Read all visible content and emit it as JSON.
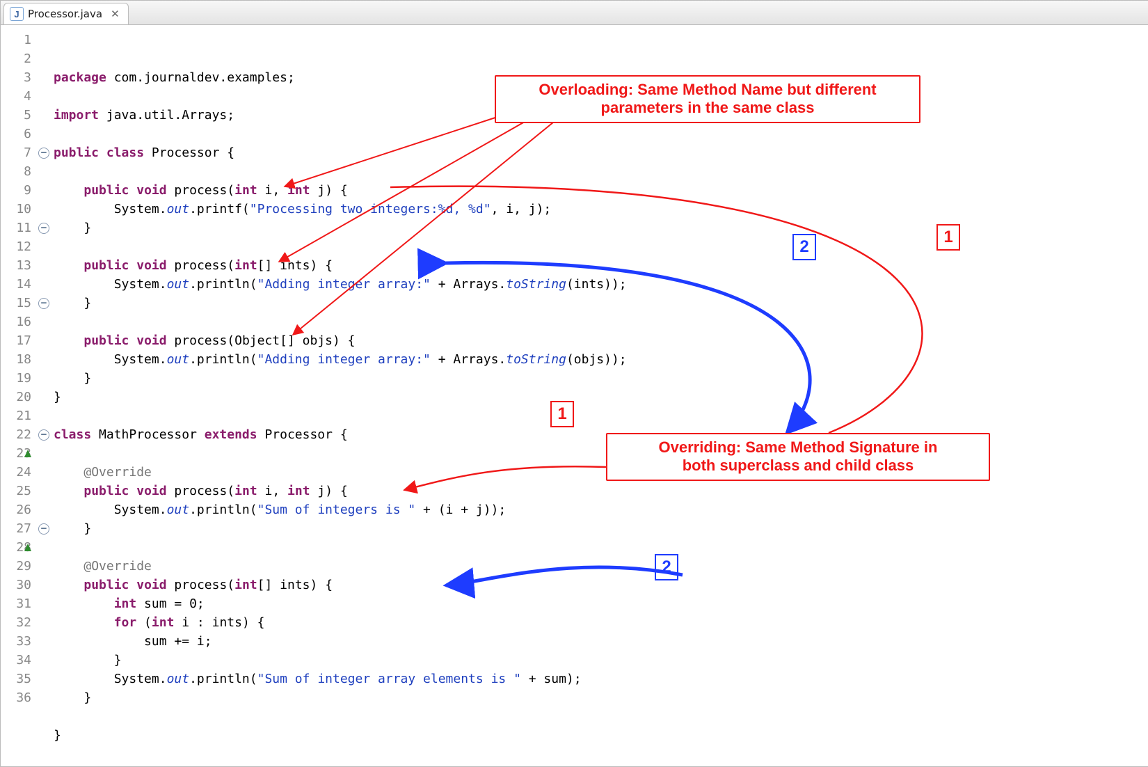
{
  "tab": {
    "icon_letter": "J",
    "filename": "Processor.java",
    "close_label": "✕"
  },
  "editor": {
    "highlighted_line_index": 3,
    "line_numbers": [
      "1",
      "2",
      "3",
      "4",
      "5",
      "6",
      "7",
      "8",
      "9",
      "10",
      "11",
      "12",
      "13",
      "14",
      "15",
      "16",
      "17",
      "18",
      "19",
      "20",
      "21",
      "22",
      "23",
      "24",
      "25",
      "26",
      "27",
      "28",
      "29",
      "30",
      "31",
      "32",
      "33",
      "34",
      "35",
      "36"
    ],
    "code": {
      "l1_kw1": "package",
      "l1_rest": " com.journaldev.examples;",
      "l3_kw1": "import",
      "l3_rest": " java.util.Arrays;",
      "l5_kw1": "public",
      "l5_kw2": "class",
      "l5_rest": " Processor {",
      "l7_kw1": "public",
      "l7_kw2": "void",
      "l7_mid": " process(",
      "l7_kw3": "int",
      "l7_mid2": " i, ",
      "l7_kw4": "int",
      "l7_end": " j) {",
      "l8_pre": "        System.",
      "l8_out": "out",
      "l8_mid": ".printf(",
      "l8_str": "\"Processing two integers:%d, %d\"",
      "l8_end": ", i, j);",
      "l9_close": "    }",
      "l11_kw1": "public",
      "l11_kw2": "void",
      "l11_mid": " process(",
      "l11_kw3": "int",
      "l11_end": "[] ints) {",
      "l12_pre": "        System.",
      "l12_out": "out",
      "l12_mid": ".println(",
      "l12_str": "\"Adding integer array:\"",
      "l12_mid2": " + Arrays.",
      "l12_mi": "toString",
      "l12_end": "(ints));",
      "l13_close": "    }",
      "l15_kw1": "public",
      "l15_kw2": "void",
      "l15_end": " process(Object[] objs) {",
      "l16_pre": "        System.",
      "l16_out": "out",
      "l16_mid": ".println(",
      "l16_str": "\"Adding integer array:\"",
      "l16_mid2": " + Arrays.",
      "l16_mi": "toString",
      "l16_end": "(objs));",
      "l17_close": "    }",
      "l18_close": "}",
      "l20_kw1": "class",
      "l20_mid": " MathProcessor ",
      "l20_kw2": "extends",
      "l20_end": " Processor {",
      "l22_ann": "@Override",
      "l23_kw1": "public",
      "l23_kw2": "void",
      "l23_mid": " process(",
      "l23_kw3": "int",
      "l23_mid2": " i, ",
      "l23_kw4": "int",
      "l23_end": " j) {",
      "l24_pre": "        System.",
      "l24_out": "out",
      "l24_mid": ".println(",
      "l24_str": "\"Sum of integers is \"",
      "l24_end": " + (i + j));",
      "l25_close": "    }",
      "l27_ann": "@Override",
      "l28_kw1": "public",
      "l28_kw2": "void",
      "l28_mid": " process(",
      "l28_kw3": "int",
      "l28_end": "[] ints) {",
      "l29_pre": "        ",
      "l29_kw1": "int",
      "l29_end": " sum = 0;",
      "l30_pre": "        ",
      "l30_kw1": "for",
      "l30_mid": " (",
      "l30_kw2": "int",
      "l30_end": " i : ints) {",
      "l31": "            sum += i;",
      "l32_close": "        }",
      "l33_pre": "        System.",
      "l33_out": "out",
      "l33_mid": ".println(",
      "l33_str": "\"Sum of integer array elements is \"",
      "l33_end": " + sum);",
      "l34_close": "    }",
      "l36_close": "}"
    }
  },
  "collapse_markers": [
    7,
    11,
    15,
    22,
    27
  ],
  "override_markers": [
    23,
    28
  ],
  "callouts": {
    "overloading": "Overloading: Same Method Name but different\nparameters in the same class",
    "overriding": "Overriding: Same Method Signature in\nboth superclass and child class"
  },
  "number_labels": {
    "red1": "1",
    "red1b": "1",
    "blue2": "2",
    "blue2b": "2"
  }
}
